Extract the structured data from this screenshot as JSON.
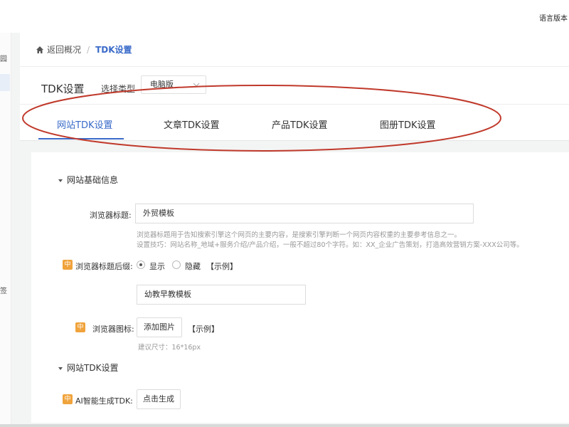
{
  "topbar": {
    "lang_text": "语言版本"
  },
  "sidebar": {
    "fragments": [
      "园",
      "签"
    ]
  },
  "breadcrumb": {
    "back_label": "返回概况",
    "separator": "/",
    "current": "TDK设置"
  },
  "header": {
    "title": "TDK设置",
    "type_label": "选择类型",
    "type_selected": "电脑版"
  },
  "tabs": [
    {
      "label": "网站TDK设置"
    },
    {
      "label": "文章TDK设置"
    },
    {
      "label": "产品TDK设置"
    },
    {
      "label": "图册TDK设置"
    }
  ],
  "annotation": {
    "color": "#c0392b"
  },
  "accent_color": "#3a6bc9",
  "badge_color": "#f0a33c",
  "sections": {
    "basic": {
      "title": "网站基础信息",
      "browser_title_label": "浏览器标题:",
      "browser_title_value": "外贸模板",
      "hint_line1": "浏览器标题用于告知搜索引擎这个网页的主要内容，是搜索引擎判断一个网页内容权重的主要参考信息之一。",
      "hint_line2": "设置技巧：网站名称_地域+服务介绍/产品介绍，一般不超过80个字符。如：XX_企业广告策划，打造高效营销方案-XXX公司等。",
      "badge": "中",
      "suffix_label": "浏览器标题后缀:",
      "option_show": "显示",
      "option_hide": "隐藏",
      "example": "【示例】",
      "suffix_value": "幼教早教模板",
      "icon_label": "浏览器图标:",
      "add_image": "添加图片",
      "icon_example": "【示例】",
      "size_hint": "建议尺寸：16*16px"
    },
    "tdk": {
      "title": "网站TDK设置",
      "badge": "中",
      "ai_label": "AI智能生成TDK:",
      "generate": "点击生成"
    }
  }
}
